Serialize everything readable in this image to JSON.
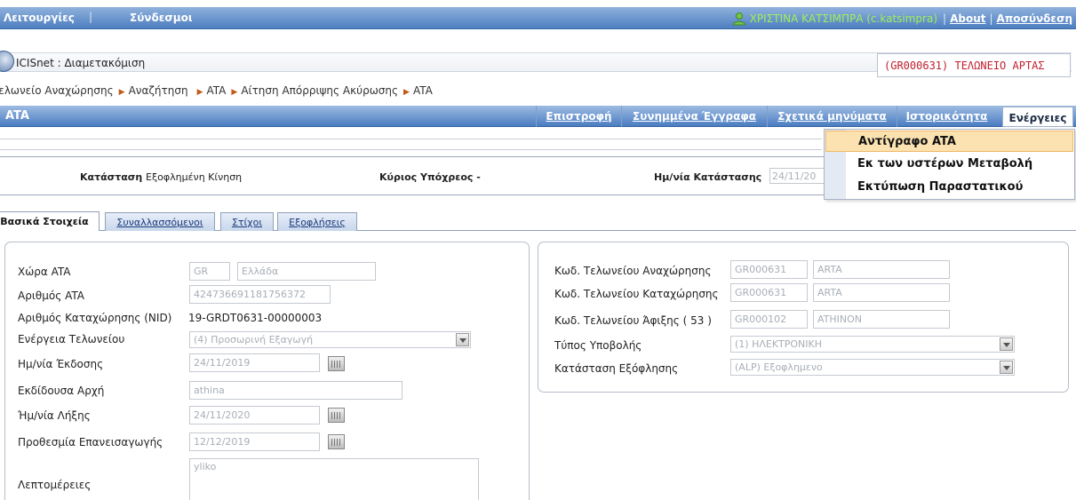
{
  "topbar": {
    "menu_functions": "Λειτουργίες",
    "menu_links": "Σύνδεσμοι",
    "user": "ΧΡΙΣΤΙΝΑ ΚΑΤΣΙΜΠΡΑ (c.katsimpra)",
    "about": "About",
    "logout": "Αποσύνδεση"
  },
  "app": {
    "title": "ICISnet : Διαμετακόμιση",
    "office": "(GR000631) ΤΕΛΩΝΕΙΟ ΑΡΤΑΣ"
  },
  "breadcrumb": [
    "Τελωνείο Αναχώρησης",
    "Αναζήτηση",
    "ATA",
    "Αίτηση Απόρριψης Ακύρωσης",
    "ATA"
  ],
  "actionbar": {
    "title": "ATA",
    "return": "Επιστροφή",
    "attached_docs": "Συνημμένα Έγγραφα",
    "related_msgs": "Σχετικά μηνύματα",
    "history": "Ιστορικότητα",
    "actions": "Ενέργειες"
  },
  "dropdown": {
    "items": [
      "Αντίγραφο ATA",
      "Εκ των υστέρων Μεταβολή",
      "Εκτύπωση Παραστατικού"
    ]
  },
  "status": {
    "state_label": "Κατάσταση",
    "state_value": "Εξοφλημένη Κίνηση",
    "obligor_label": "Κύριος Υπόχρεος",
    "obligor_value": "-",
    "date_label": "Ημ/νία Κατάστασης",
    "date_value": "24/11/20"
  },
  "tabs": [
    "Βασικά Στοιχεία",
    "Συναλλασσόμενοι",
    "Στίχοι",
    "Εξοφλήσεις"
  ],
  "left": {
    "country_label": "Χώρα ATA",
    "country_code": "GR",
    "country_name": "Ελλάδα",
    "ata_number_label": "Αριθμός ATA",
    "ata_number": "424736691181756372",
    "nid_label": "Αριθμός Καταχώρησης (NID)",
    "nid": "19-GRDT0631-00000003",
    "customs_action_label": "Ενέργεια Τελωνείου",
    "customs_action": "(4) Προσωρινή Εξαγωγή",
    "issue_date_label": "Ημ/νία Έκδοσης",
    "issue_date": "24/11/2019",
    "issuing_authority_label": "Εκδίδουσα Αρχή",
    "issuing_authority": "athina",
    "expiry_date_label": "Ήμ/νία Λήξης",
    "expiry_date": "24/11/2020",
    "reimport_deadline_label": "Προθεσμία Επανεισαγωγής",
    "reimport_deadline": "12/12/2019",
    "details_label": "Λεπτομέρειες",
    "details": "yliko"
  },
  "right": {
    "dep_label": "Κωδ. Τελωνείου Αναχώρησης",
    "dep_code": "GR000631",
    "dep_name": "ARTA",
    "reg_label": "Κωδ. Τελωνείου Καταχώρησης",
    "reg_code": "GR000631",
    "reg_name": "ARTA",
    "arr_label": "Κωδ. Τελωνείου Άφιξης ( 53 )",
    "arr_code": "GR000102",
    "arr_name": "ATHINON",
    "sub_type_label": "Τύπος Υποβολής",
    "sub_type": "(1) ΗΛΕΚΤΡΟΝΙΚΗ",
    "pay_status_label": "Κατάσταση Εξόφλησης",
    "pay_status": "(ALP) Εξοφλημενο"
  },
  "colors": {
    "bar": "#4d7fc0",
    "office_text": "#c02030",
    "highlight": "#fbe2b0",
    "user_text": "#9ff05a"
  }
}
